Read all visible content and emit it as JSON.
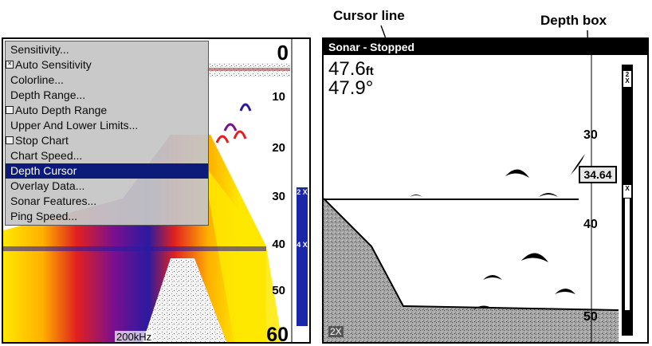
{
  "callouts": {
    "cursor_line": "Cursor line",
    "depth_box": "Depth box"
  },
  "left_screen": {
    "menu_items": [
      {
        "label": "Sensitivity...",
        "checkbox": false
      },
      {
        "label": "Auto Sensitivity",
        "checkbox": true,
        "checked": true
      },
      {
        "label": "Colorline...",
        "checkbox": false
      },
      {
        "label": "Depth Range...",
        "checkbox": false
      },
      {
        "label": "Auto Depth Range",
        "checkbox": true,
        "checked": false
      },
      {
        "label": "Upper And Lower Limits...",
        "checkbox": false
      },
      {
        "label": "Stop Chart",
        "checkbox": true,
        "checked": false
      },
      {
        "label": "Chart Speed...",
        "checkbox": false
      },
      {
        "label": "Depth Cursor",
        "checkbox": false,
        "selected": true
      },
      {
        "label": "Overlay Data...",
        "checkbox": false
      },
      {
        "label": "Sonar Features...",
        "checkbox": false
      },
      {
        "label": "Ping Speed...",
        "checkbox": false
      }
    ],
    "depth_scale": {
      "d0": "0",
      "d10": "10",
      "d20": "20",
      "d30": "30",
      "d40": "40",
      "d50": "50",
      "d60": "60"
    },
    "frequency": "200kHz",
    "zoom_2x": "2 X",
    "zoom_4x": "4 X",
    "colors": {
      "menu_selected": "#0c1a7a",
      "zoom_bar": "#1a27a8"
    }
  },
  "right_screen": {
    "title": "Sonar - Stopped",
    "depth_value": "47.6",
    "depth_unit": "ft",
    "temperature": "47.9°",
    "depth_scale": {
      "d30": "30",
      "d40": "40",
      "d50": "50"
    },
    "cursor_depth": "34.64",
    "zoom_top": "2 X",
    "zoom_mid": "X",
    "zoom_corner": "2X"
  }
}
